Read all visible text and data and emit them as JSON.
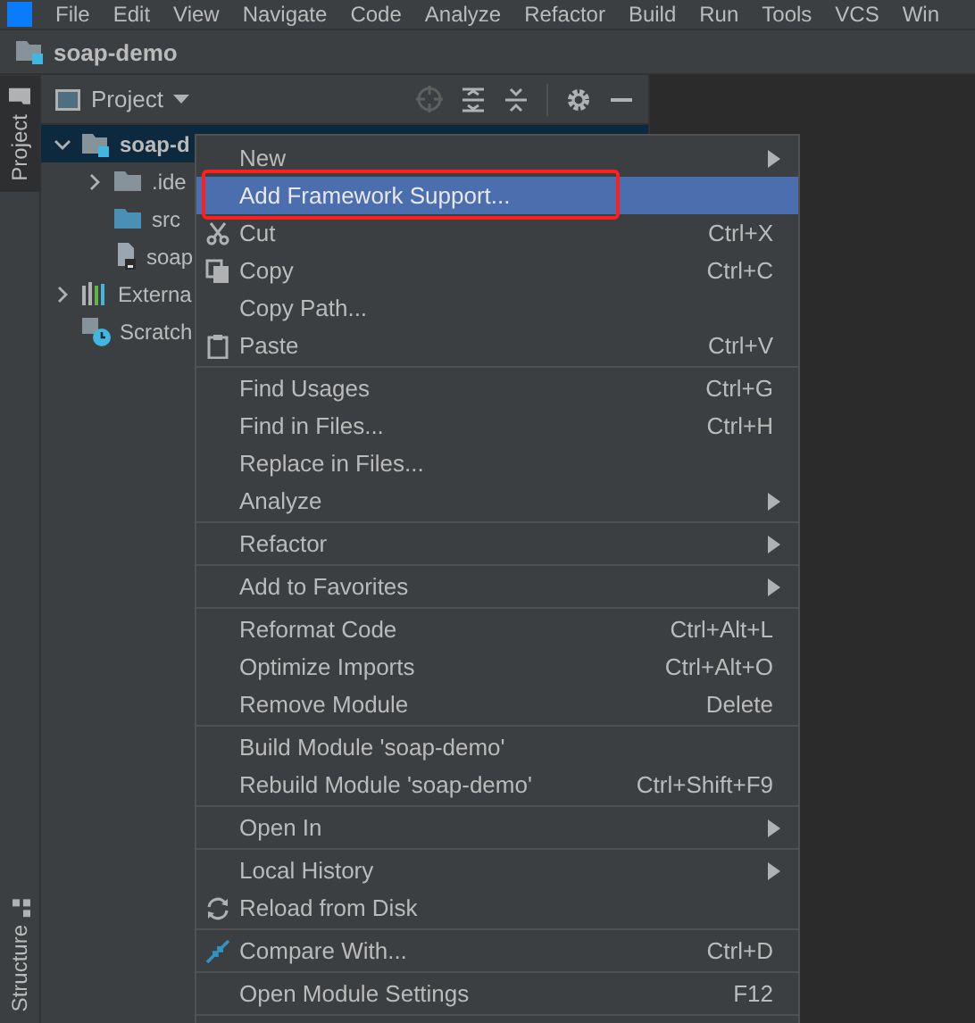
{
  "menu_bar": {
    "items": [
      "File",
      "Edit",
      "View",
      "Navigate",
      "Code",
      "Analyze",
      "Refactor",
      "Build",
      "Run",
      "Tools",
      "VCS",
      "Win"
    ]
  },
  "title_bar": {
    "project": "soap-demo"
  },
  "left_stripe": {
    "tabs": [
      {
        "label": "Project",
        "selected": true
      },
      {
        "label": "Structure",
        "selected": false
      }
    ]
  },
  "project_panel": {
    "title": "Project",
    "tree": [
      {
        "label": "soap-d",
        "kind": "module",
        "expanded": true,
        "selected": true,
        "children": [
          {
            "label": ".ide",
            "kind": "folder",
            "expanded": false,
            "selected": false
          },
          {
            "label": "src",
            "kind": "source",
            "selected": false
          },
          {
            "label": "soap",
            "kind": "file",
            "selected": false
          }
        ]
      },
      {
        "label": "Externa",
        "kind": "libraries",
        "expanded": false,
        "selected": false
      },
      {
        "label": "Scratch",
        "kind": "scratches",
        "selected": false
      }
    ]
  },
  "context_menu": {
    "groups": [
      [
        {
          "label": "New",
          "submenu": true,
          "selected": false
        },
        {
          "label": "Add Framework Support...",
          "submenu": false,
          "selected": true
        },
        {
          "label": "Cut",
          "shortcut": "Ctrl+X",
          "submenu": false,
          "selected": false
        },
        {
          "label": "Copy",
          "shortcut": "Ctrl+C",
          "submenu": false,
          "selected": false
        },
        {
          "label": "Copy Path...",
          "submenu": false,
          "selected": false
        },
        {
          "label": "Paste",
          "shortcut": "Ctrl+V",
          "submenu": false,
          "selected": false
        }
      ],
      [
        {
          "label": "Find Usages",
          "shortcut": "Ctrl+G",
          "submenu": false,
          "selected": false
        },
        {
          "label": "Find in Files...",
          "shortcut": "Ctrl+H",
          "submenu": false,
          "selected": false
        },
        {
          "label": "Replace in Files...",
          "submenu": false,
          "selected": false
        },
        {
          "label": "Analyze",
          "submenu": true,
          "selected": false
        }
      ],
      [
        {
          "label": "Refactor",
          "submenu": true,
          "selected": false
        }
      ],
      [
        {
          "label": "Add to Favorites",
          "submenu": true,
          "selected": false
        }
      ],
      [
        {
          "label": "Reformat Code",
          "shortcut": "Ctrl+Alt+L",
          "submenu": false,
          "selected": false
        },
        {
          "label": "Optimize Imports",
          "shortcut": "Ctrl+Alt+O",
          "submenu": false,
          "selected": false
        },
        {
          "label": "Remove Module",
          "shortcut": "Delete",
          "submenu": false,
          "selected": false
        }
      ],
      [
        {
          "label": "Build Module 'soap-demo'",
          "submenu": false,
          "selected": false
        },
        {
          "label": "Rebuild Module 'soap-demo'",
          "shortcut": "Ctrl+Shift+F9",
          "submenu": false,
          "selected": false
        }
      ],
      [
        {
          "label": "Open In",
          "submenu": true,
          "selected": false
        }
      ],
      [
        {
          "label": "Local History",
          "submenu": true,
          "selected": false
        },
        {
          "label": "Reload from Disk",
          "submenu": false,
          "selected": false
        }
      ],
      [
        {
          "label": "Compare With...",
          "shortcut": "Ctrl+D",
          "submenu": false,
          "selected": false
        }
      ],
      [
        {
          "label": "Open Module Settings",
          "shortcut": "F12",
          "submenu": false,
          "selected": false
        }
      ]
    ]
  }
}
